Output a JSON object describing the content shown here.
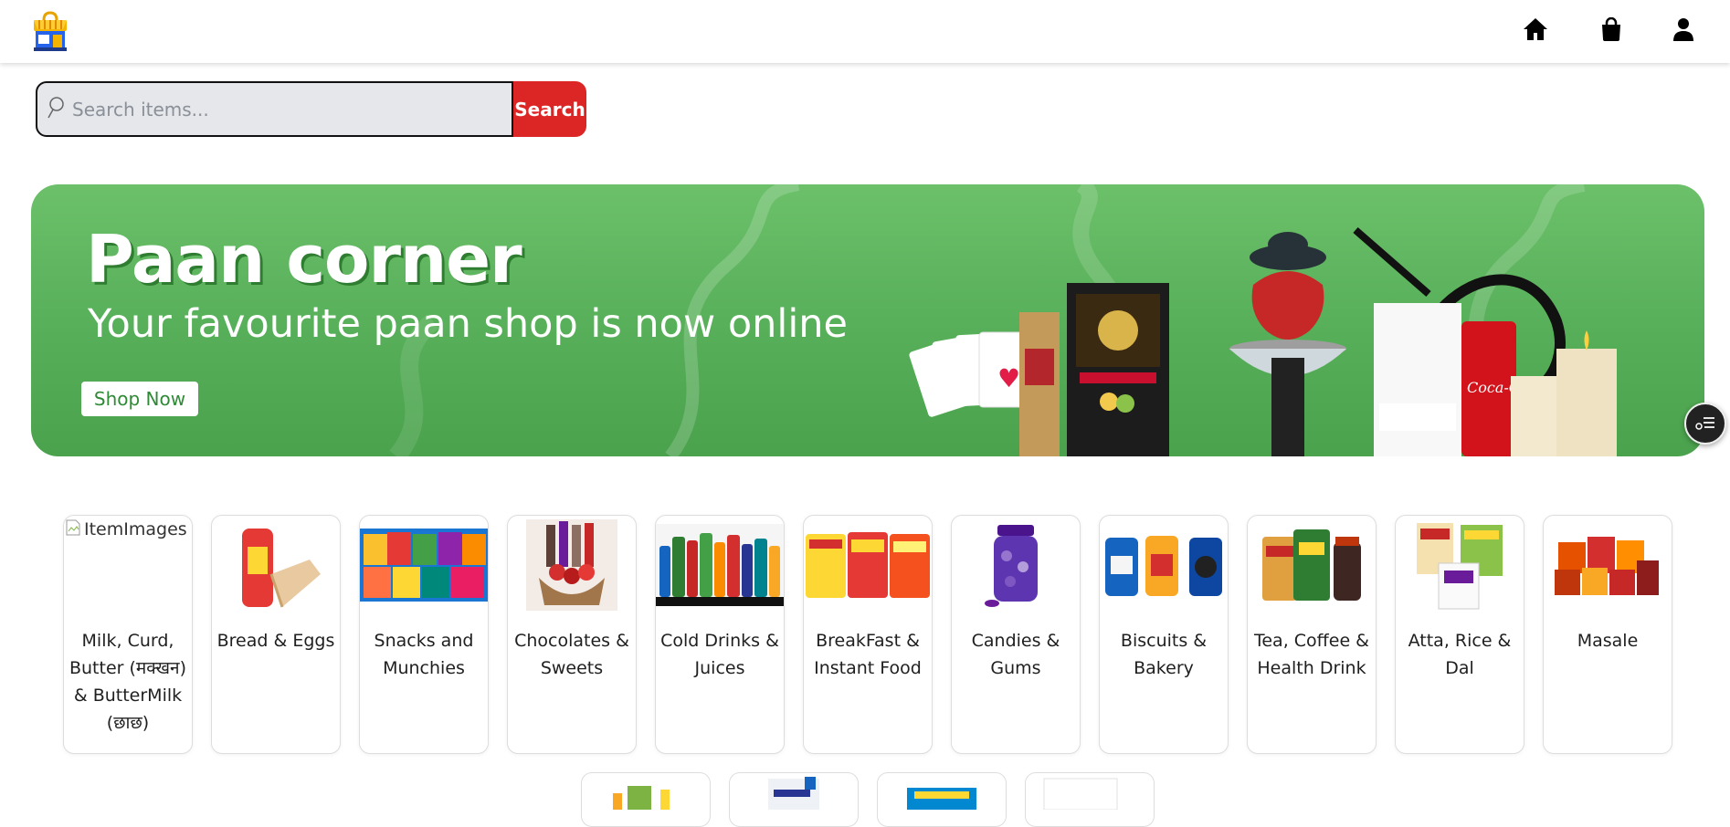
{
  "nav": {
    "logo": "shop-logo",
    "icons": [
      "home-icon",
      "shopping-bag-icon",
      "user-icon"
    ]
  },
  "search": {
    "placeholder": "Search items...",
    "button_label": "Search"
  },
  "banner": {
    "title": "Paan corner",
    "subtitle": "Your favourite paan shop is now online",
    "cta_label": "Shop Now",
    "colors": {
      "background": "#5cb55c",
      "cta_text": "#2f8a36"
    }
  },
  "categories": [
    {
      "label": "Milk, Curd, Butter (मक्खन) & ButterMilk (छाछ)",
      "image_alt": "ItemImages",
      "broken": true
    },
    {
      "label": "Bread & Eggs"
    },
    {
      "label": "Snacks and Munchies"
    },
    {
      "label": "Chocolates & Sweets"
    },
    {
      "label": "Cold Drinks & Juices"
    },
    {
      "label": "BreakFast & Instant Food"
    },
    {
      "label": "Candies & Gums"
    },
    {
      "label": "Biscuits & Bakery"
    },
    {
      "label": "Tea, Coffee & Health Drink"
    },
    {
      "label": "Atta, Rice & Dal"
    },
    {
      "label": "Masale"
    }
  ],
  "colors": {
    "search_button": "#dc2626",
    "search_box": "#e5e7eb"
  }
}
